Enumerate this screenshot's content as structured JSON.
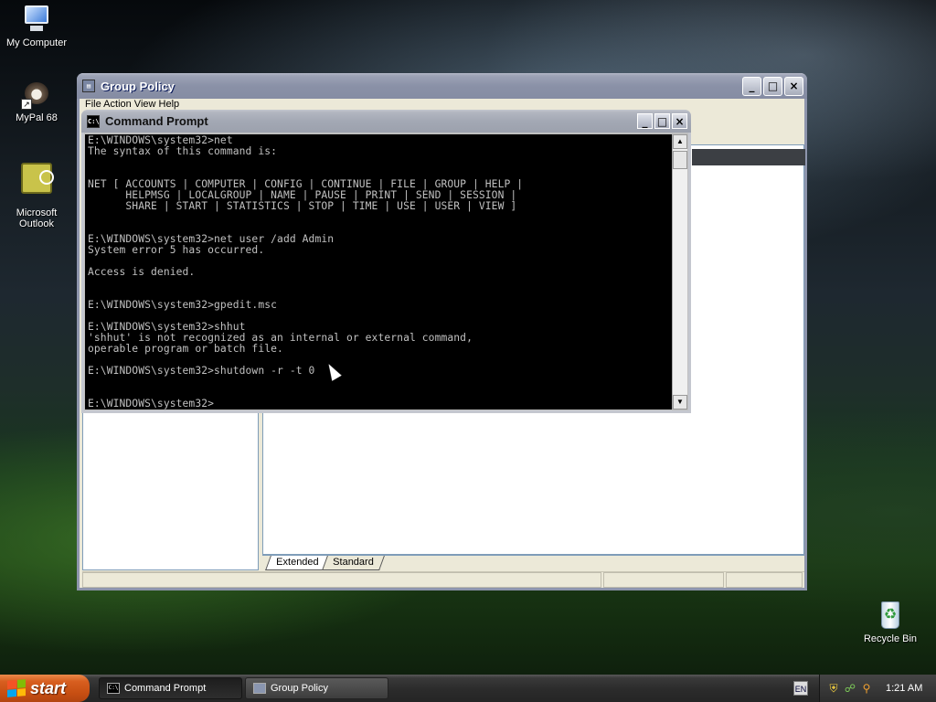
{
  "desktop": {
    "icons": [
      {
        "label": "My Computer",
        "icon": "computer-icon"
      },
      {
        "label": "MyPal 68",
        "icon": "mypal-browser-icon"
      },
      {
        "label": "Microsoft\nOutlook",
        "icon": "outlook-icon"
      },
      {
        "label": "Recycle Bin",
        "icon": "recycle-bin-icon"
      }
    ]
  },
  "group_policy": {
    "title": "Group Policy",
    "menubar": "File   Action   View   Help",
    "tabs": [
      "Extended",
      "Standard"
    ],
    "active_tab": "Extended"
  },
  "command_prompt": {
    "title": "Command Prompt",
    "lines": [
      "E:\\WINDOWS\\system32>net",
      "The syntax of this command is:",
      "",
      "",
      "NET [ ACCOUNTS | COMPUTER | CONFIG | CONTINUE | FILE | GROUP | HELP |",
      "      HELPMSG | LOCALGROUP | NAME | PAUSE | PRINT | SEND | SESSION |",
      "      SHARE | START | STATISTICS | STOP | TIME | USE | USER | VIEW ]",
      "",
      "",
      "E:\\WINDOWS\\system32>net user /add Admin",
      "System error 5 has occurred.",
      "",
      "Access is denied.",
      "",
      "",
      "E:\\WINDOWS\\system32>gpedit.msc",
      "",
      "E:\\WINDOWS\\system32>shhut",
      "'shhut' is not recognized as an internal or external command,",
      "operable program or batch file.",
      "",
      "E:\\WINDOWS\\system32>shutdown -r -t 0",
      "",
      "",
      "E:\\WINDOWS\\system32>"
    ]
  },
  "taskbar": {
    "start_label": "start",
    "buttons": [
      {
        "label": "Command Prompt",
        "state": "pressed"
      },
      {
        "label": "Group Policy",
        "state": "normal"
      }
    ],
    "language": "EN",
    "clock": "1:21 AM"
  },
  "window_buttons": {
    "minimize": "_",
    "maximize": "□",
    "close": "×"
  }
}
